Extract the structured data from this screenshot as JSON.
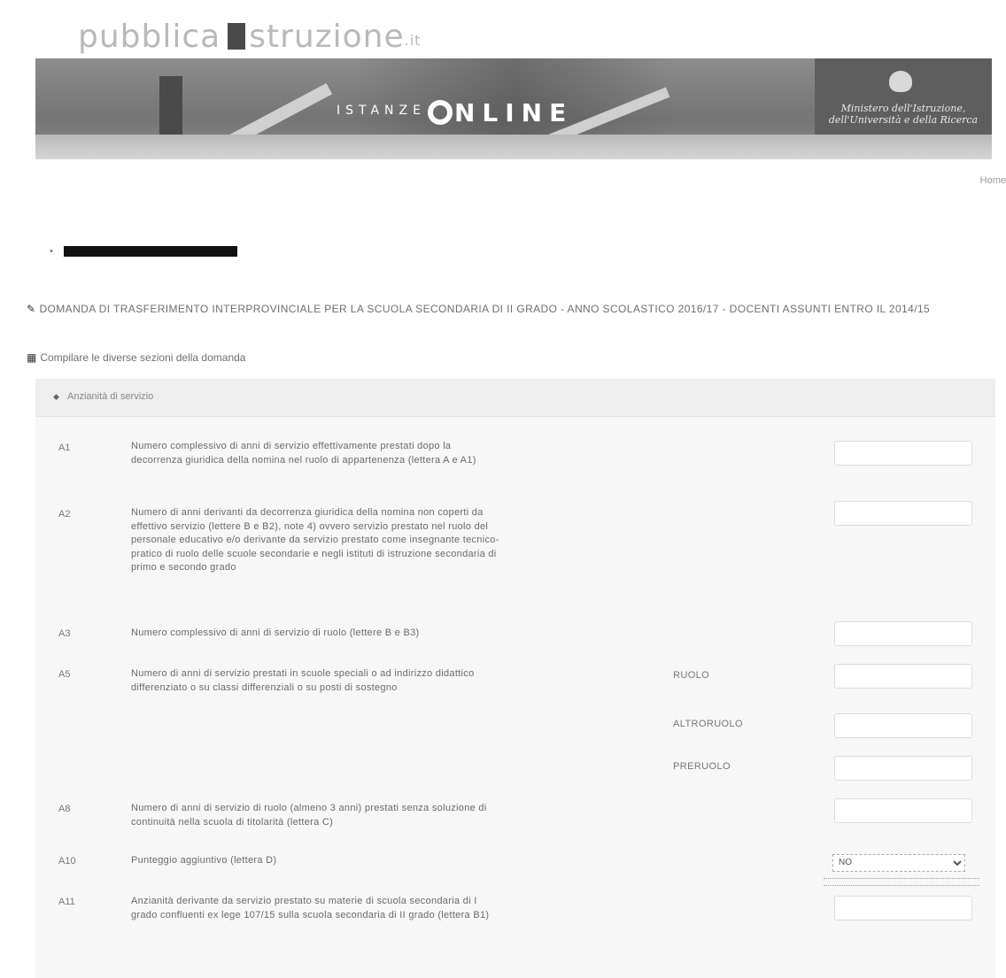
{
  "header": {
    "brand_left": "pubblica",
    "brand_right": "struzione",
    "brand_suffix": ".it",
    "banner_small": "ISTANZE",
    "banner_big": "NLINE",
    "ministry": "Ministero dell'Istruzione, dell'Università e della Ricerca"
  },
  "nav": {
    "home": "Home"
  },
  "user": {
    "bullet": "•"
  },
  "page": {
    "title": "DOMANDA DI TRASFERIMENTO INTERPROVINCIALE PER LA SCUOLA SECONDARIA DI II GRADO - ANNO SCOLASTICO 2016/17 - DOCENTI ASSUNTI ENTRO IL 2014/15",
    "subtitle": "Compilare le diverse sezioni della domanda"
  },
  "section": {
    "title": "Anzianità di servizio",
    "rows": [
      {
        "code": "A1",
        "text": "Numero complessivo di anni di servizio effettivamente prestati dopo la decorrenza giuridica della nomina nel ruolo di appartenenza (lettera A e A1)"
      },
      {
        "code": "A2",
        "text": "Numero di anni derivanti da decorrenza giuridica della nomina non coperti da effettivo servizio (lettere B e B2), note 4) ovvero servizio prestato nel ruolo del personale educativo e/o derivante da servizio prestato come insegnante tecnico-pratico di ruolo delle scuole secondarie e negli istituti di istruzione secondaria di primo e secondo grado"
      },
      {
        "code": "A3",
        "text": "Numero complessivo di anni di servizio di ruolo (lettere B e B3)"
      },
      {
        "code": "A5",
        "text": "Numero di anni di servizio prestati in scuole speciali o ad indirizzo didattico differenziato o su classi differenziali o su posti di sostegno",
        "sublabels": [
          "RUOLO",
          "ALTRORUOLO",
          "PRERUOLO"
        ]
      },
      {
        "code": "A8",
        "text": "Numero di anni di servizio di ruolo (almeno 3 anni) prestati senza soluzione di continuità nella scuola di titolarità (lettera C)"
      },
      {
        "code": "A10",
        "text": "Punteggio aggiuntivo (lettera D)",
        "select_value": "NO"
      },
      {
        "code": "A11",
        "text": "Anzianità derivante da servizio prestato su materie di scuola secondaria di I grado confluenti ex lege 107/15 sulla scuola secondaria di II grado (lettera B1)"
      }
    ]
  }
}
